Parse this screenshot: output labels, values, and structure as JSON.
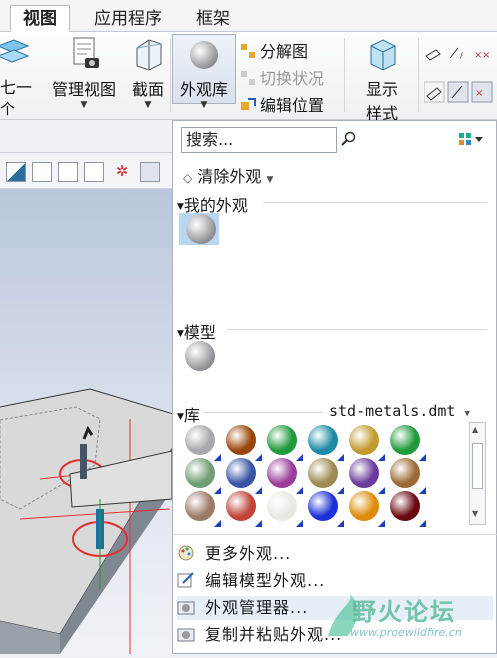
{
  "tabs": [
    "视图",
    "应用程序",
    "框架"
  ],
  "ribbon": {
    "left_partial_1": "七一",
    "left_partial_2": "个",
    "manage_views": "管理视图",
    "section": "截面",
    "appearance_gallery": "外观库",
    "explode_view": "分解图",
    "toggle_status": "切换状况",
    "edit_position": "编辑位置",
    "display_style_1": "显示",
    "display_style_2": "样式"
  },
  "panel": {
    "search_placeholder": "搜索...",
    "clear_appearance": "清除外观",
    "my_appearances": "我的外观",
    "model": "模型",
    "library": "库",
    "library_file": "std-metals.dmt",
    "more_appearances": "更多外观...",
    "edit_model_appearance": "编辑模型外观...",
    "appearance_manager": "外观管理器...",
    "copy_paste_appearance": "复制并粘贴外观..."
  },
  "library_colors": [
    "#a9a9ad",
    "#9a4508",
    "#1f9a3a",
    "#1d8aa6",
    "#c19a2e",
    "#1f9a3a",
    "#6f9e74",
    "#3a55a6",
    "#9c3d9a",
    "#9c8a52",
    "#6b3a9c",
    "#9c6a34",
    "#9c7a68",
    "#c0443a",
    "#e8e8e2",
    "#1a30d8",
    "#e08a0a",
    "#6a0812"
  ],
  "watermark": {
    "text": "野火论坛",
    "url": "www.proewildfire.cn"
  }
}
